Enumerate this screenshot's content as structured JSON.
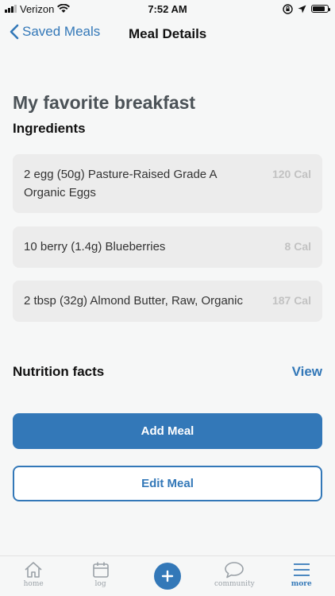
{
  "status_bar": {
    "carrier": "Verizon",
    "time": "7:52 AM",
    "battery_level": 0.85
  },
  "nav": {
    "back_label": "Saved Meals",
    "title": "Meal Details"
  },
  "meal": {
    "name": "My favorite breakfast",
    "ingredients_heading": "Ingredients",
    "ingredients": [
      {
        "name": "2 egg (50g) Pasture-Raised Grade A Organic Eggs",
        "calories": "120 Cal"
      },
      {
        "name": "10 berry (1.4g) Blueberries",
        "calories": "8 Cal"
      },
      {
        "name": "2 tbsp (32g) Almond Butter, Raw, Organic",
        "calories": "187 Cal"
      }
    ]
  },
  "nutrition": {
    "heading": "Nutrition facts",
    "view_label": "View"
  },
  "actions": {
    "add_label": "Add Meal",
    "edit_label": "Edit Meal"
  },
  "tab_bar": {
    "items": [
      {
        "label": "home",
        "icon": "home-icon"
      },
      {
        "label": "log",
        "icon": "calendar-icon"
      },
      {
        "label": "",
        "icon": "plus-icon"
      },
      {
        "label": "community",
        "icon": "chat-bubble-icon"
      },
      {
        "label": "more",
        "icon": "menu-icon"
      }
    ],
    "active": "more"
  },
  "colors": {
    "accent": "#3378b8",
    "background": "#f6f7f7",
    "card": "#ececec"
  }
}
